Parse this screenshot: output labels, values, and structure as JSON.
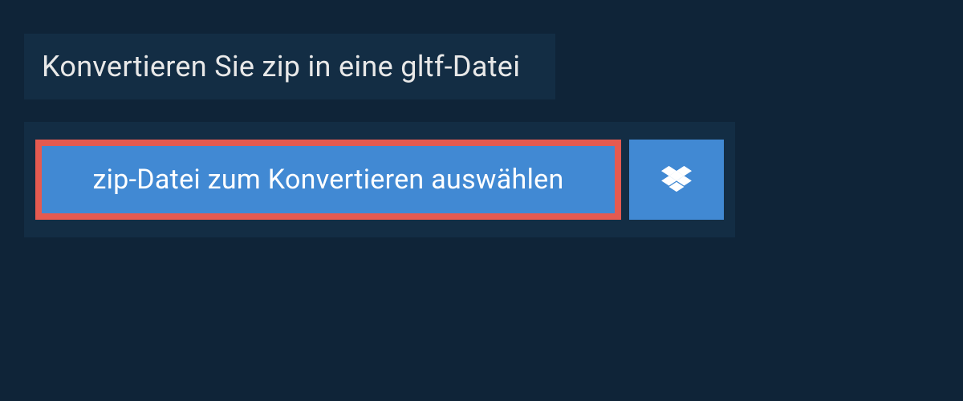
{
  "title": "Konvertieren Sie zip in eine gltf-Datei",
  "selectButton": {
    "label": "zip-Datei zum Konvertieren auswählen"
  },
  "dropboxButton": {
    "iconName": "dropbox-icon"
  },
  "colors": {
    "background": "#0f2438",
    "panel": "#132d44",
    "buttonPrimary": "#4189d3",
    "highlightBorder": "#e55a50",
    "textLight": "#e8e8e8",
    "textWhite": "#ffffff"
  }
}
